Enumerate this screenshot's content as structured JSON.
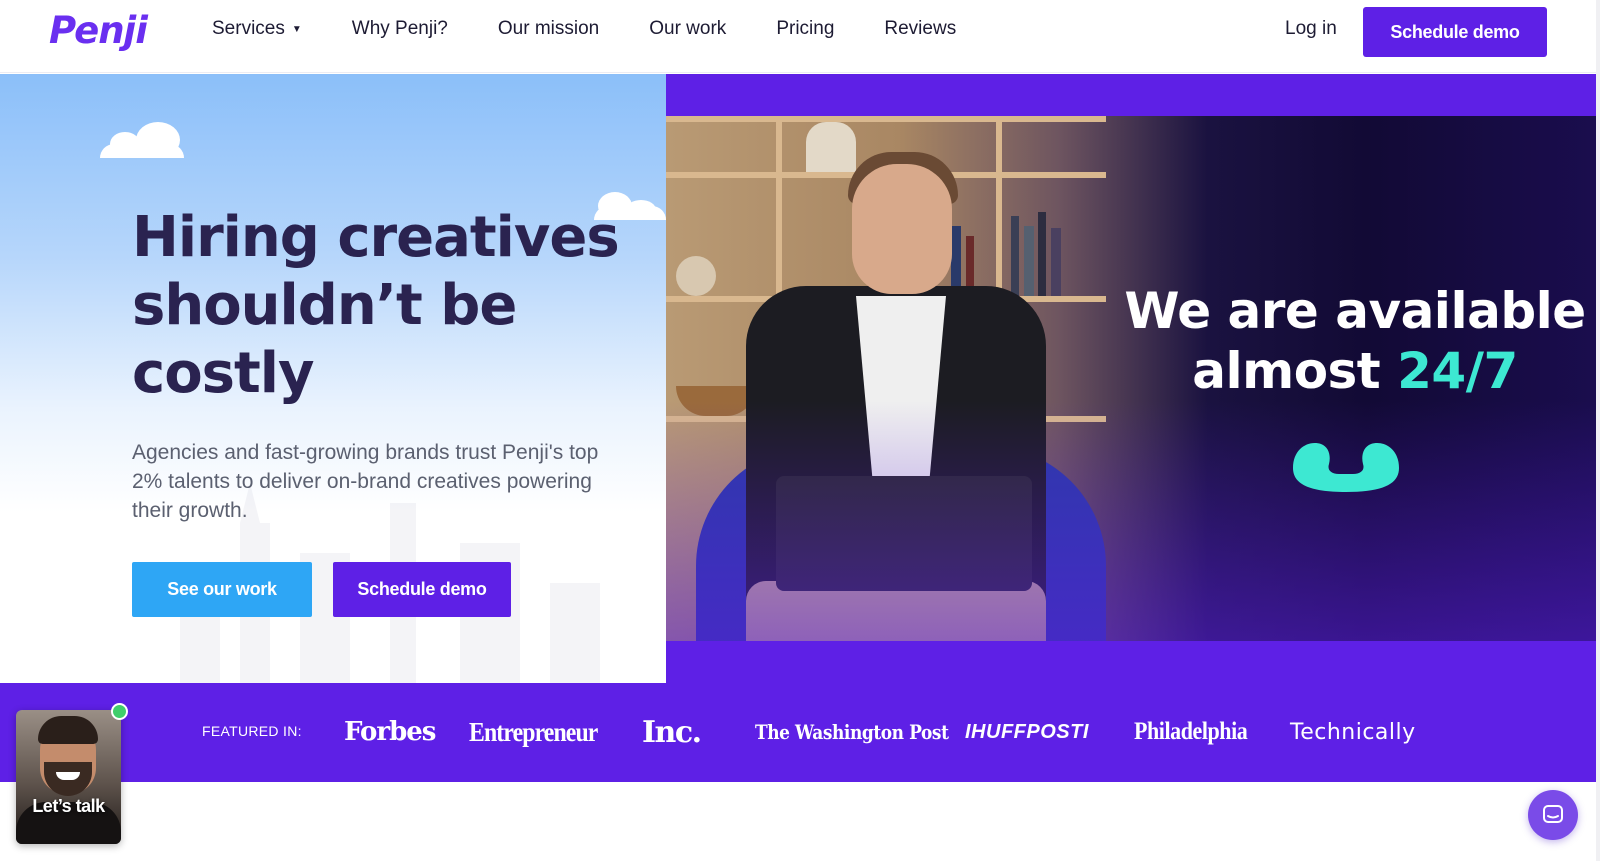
{
  "brand": {
    "logo_text": "Penji",
    "accent": "#5e20e6",
    "cyan": "#3de8d2",
    "blue_button": "#2ea6f5"
  },
  "nav": {
    "items": [
      {
        "label": "Services",
        "has_dropdown": true
      },
      {
        "label": "Why Penji?"
      },
      {
        "label": "Our mission"
      },
      {
        "label": "Our work"
      },
      {
        "label": "Pricing"
      },
      {
        "label": "Reviews"
      }
    ],
    "login": "Log in",
    "cta": "Schedule demo"
  },
  "hero": {
    "title": "Hiring creatives shouldn’t be costly",
    "subtitle": "Agencies and fast-growing brands trust Penji's top 2% talents to deliver on-brand creatives powering their growth.",
    "primary_button": "See our work",
    "secondary_button": "Schedule demo"
  },
  "video": {
    "line1": "We are available",
    "line2_prefix": "almost ",
    "line2_highlight": "24/7",
    "icon": "phone-icon"
  },
  "featured": {
    "label": "FEATURED IN:",
    "outlets": [
      "Forbes",
      "Entrepreneur",
      "Inc.",
      "The Washington Post",
      "IHUFFPOSTI",
      "Philadelphia",
      "Technically"
    ]
  },
  "widgets": {
    "talk_label": "Let’s talk",
    "chat_icon": "chat-bubble-icon"
  }
}
